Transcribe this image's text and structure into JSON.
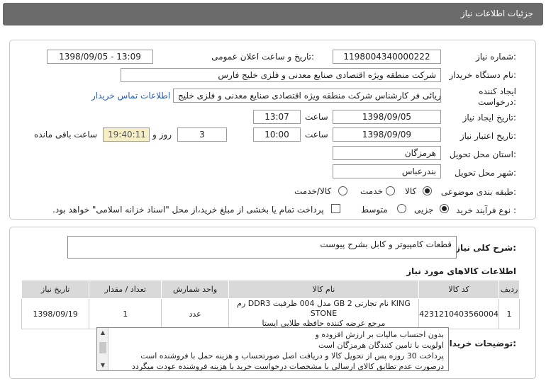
{
  "header": {
    "title": "جزئیات اطلاعات نیاز"
  },
  "form": {
    "need_number_label": "شماره نیاز:",
    "need_number": "1198004340000222",
    "announce_label": "تاریخ و ساعت اعلان عمومی:",
    "announce_value": "1398/09/05 - 13:09",
    "buyer_label": "نام دستگاه خریدار:",
    "buyer_value": "شرکت منطقه ویژه اقتصادی صنایع معدنی و فلزی خلیج فارس",
    "creator_label": "ایجاد کننده درخواست:",
    "creator_value": "لیلا آریائی فر کارشناس شرکت منطقه ویژه اقتصادی صنایع معدنی و فلزی خلیج",
    "contact_link": "اطلاعات تماس خریدار",
    "created_date_label": "تاریخ ایجاد نیاز:",
    "created_date": "1398/09/05",
    "time_label": "ساعت",
    "created_time": "13:07",
    "valid_date_label": "تاریخ اعتبار نیاز:",
    "valid_date": "1398/09/09",
    "valid_time": "10:00",
    "days_value": "3",
    "days_label": "روز و",
    "remaining_time": "19:40:11",
    "remaining_label": "ساعت باقی مانده",
    "province_label": "استان محل تحویل:",
    "province_value": "هرمزگان",
    "city_label": "شهر محل تحویل:",
    "city_value": "بندرعباس",
    "category_label": "طبقه بندی موضوعی:",
    "category_options": [
      "کالا",
      "خدمت",
      "کالا/خدمت"
    ],
    "process_label": "نوع فرآیند خرید :",
    "process_options": [
      "جزیی",
      "متوسط"
    ],
    "payment_note": "پرداخت تمام یا بخشی از مبلغ خرید،از محل \"اسناد خزانه اسلامی\" خواهد بود."
  },
  "description": {
    "label": "شرح کلی نیاز:",
    "value": "قطعات کامپیوتر و کابل بشرح پیوست"
  },
  "goods": {
    "title": "اطلاعات کالاهای مورد نیاز",
    "headers": [
      "ردیف",
      "کد کالا",
      "نام کالا",
      "واحد شمارش",
      "تعداد / مقدار",
      "تاریخ نیاز"
    ],
    "row": {
      "index": "1",
      "code": "4231210403560004",
      "name_line1": "رم DDR3 مدل 004 ظرفیت GB 2 نام تجارتی KING STONE",
      "name_line2": "مرجع عرضه کننده حافظه طلایی ایستا",
      "unit": "عدد",
      "qty": "1",
      "date": "1398/09/19"
    }
  },
  "notes": {
    "label": "توضیحات خریدار:",
    "lines": [
      "بدون احتساب مالیات بر ارزش افزوده و",
      "اولویت با تامین کنندگان هرمزگان است",
      "پرداخت 30 روزه پس از تحویل کالا و دریافت اصل صورتحساب و هزینه حمل با فروشنده است",
      "درصورت عدم تطابق کالای ارسالی با مشخصات درخواست خرید با هزینه فروشنده عودت میگردد"
    ]
  }
}
